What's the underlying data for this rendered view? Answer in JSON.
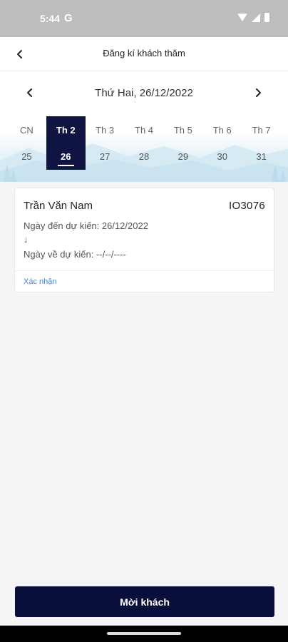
{
  "status_bar": {
    "time": "5:44",
    "g_label": "G",
    "wifi_icon": "wifi-icon",
    "signal_icon": "signal-icon",
    "battery_icon": "battery-icon"
  },
  "app_bar": {
    "back_icon": "back-arrow-icon",
    "title": "Đăng kí khách thăm"
  },
  "calendar": {
    "current_date": "Thứ Hai, 26/12/2022",
    "prev_icon": "chevron-left-icon",
    "next_icon": "chevron-right-icon",
    "days": [
      {
        "name": "CN",
        "num": "25"
      },
      {
        "name": "Th 2",
        "num": "26"
      },
      {
        "name": "Th 3",
        "num": "27"
      },
      {
        "name": "Th 4",
        "num": "28"
      },
      {
        "name": "Th 5",
        "num": "29"
      },
      {
        "name": "Th 6",
        "num": "30"
      },
      {
        "name": "Th 7",
        "num": "31"
      }
    ],
    "selected_index": 1
  },
  "visit": {
    "name": "Trần Văn Nam",
    "code": "IO3076",
    "arrival": "Ngày đến dự kiến: 26/12/2022",
    "arrow": "↓",
    "departure": "Ngày về dự kiến: --/--/----",
    "confirm_label": "Xác nhận"
  },
  "invite_button": {
    "label": "Mời khách"
  },
  "colors": {
    "primary": "#0f1443",
    "link": "#4a7fd6",
    "status_bar": "#bdbdbd"
  }
}
